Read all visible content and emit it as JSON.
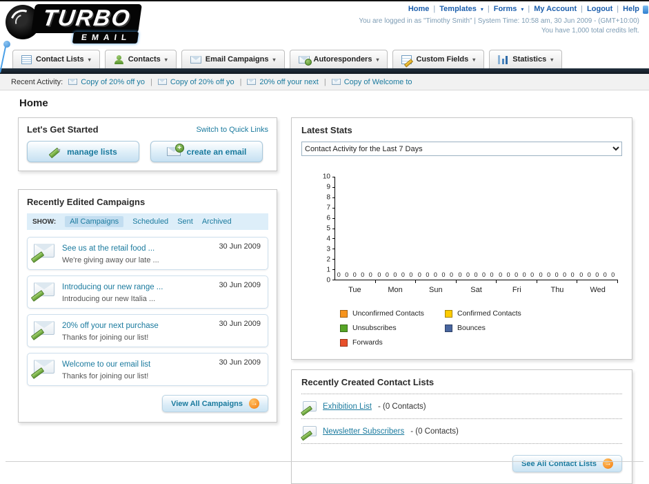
{
  "icons": {
    "caret": "▾",
    "pipe": "|",
    "arrow": "→"
  },
  "header": {
    "logo_title": "TURBO",
    "logo_subtitle": "EMAIL",
    "links": [
      {
        "label": "Home"
      },
      {
        "label": "Templates"
      },
      {
        "label": "Forms"
      },
      {
        "label": "My Account"
      },
      {
        "label": "Logout"
      },
      {
        "label": "Help"
      }
    ],
    "login_info": "You are logged in as \"Timothy Smith\" | System Time: 10:58 am, 30 Jun 2009 - (GMT+10:00)",
    "credits_info": "You have 1,000 total credits left."
  },
  "nav": {
    "tabs": [
      {
        "label": "Contact Lists"
      },
      {
        "label": "Contacts"
      },
      {
        "label": "Email Campaigns"
      },
      {
        "label": "Autoresponders"
      },
      {
        "label": "Custom Fields"
      },
      {
        "label": "Statistics"
      }
    ]
  },
  "recent_activity": {
    "label": "Recent Activity:",
    "items": [
      "Copy of 20% off yo",
      "Copy of 20% off yo",
      "20% off your next",
      "Copy of Welcome to"
    ]
  },
  "page": {
    "title": "Home"
  },
  "get_started": {
    "title": "Let's Get Started",
    "switch_link": "Switch to Quick Links",
    "manage_lists": "manage lists",
    "create_email": "create an email"
  },
  "campaigns": {
    "title": "Recently Edited Campaigns",
    "show_label": "SHOW:",
    "filters": [
      {
        "label": "All Campaigns"
      },
      {
        "label": "Scheduled"
      },
      {
        "label": "Sent"
      },
      {
        "label": "Archived"
      }
    ],
    "active_filter": "All Campaigns",
    "items": [
      {
        "title": "See us at the retail food ...",
        "subtitle": "We're giving away our late ...",
        "date": "30 Jun 2009"
      },
      {
        "title": "Introducing our new range ...",
        "subtitle": "Introducing our new Italia ...",
        "date": "30 Jun 2009"
      },
      {
        "title": "20% off your next purchase",
        "subtitle": "Thanks for joining our list!",
        "date": "30 Jun 2009"
      },
      {
        "title": "Welcome to our email list",
        "subtitle": "Thanks for joining our list!",
        "date": "30 Jun 2009"
      }
    ],
    "view_all": "View All Campaigns"
  },
  "stats": {
    "title": "Latest Stats",
    "filter_value": "Contact Activity for the Last 7 Days",
    "chart_data": {
      "type": "bar",
      "categories": [
        "Tue",
        "Mon",
        "Sun",
        "Sat",
        "Fri",
        "Thu",
        "Wed"
      ],
      "series": [
        {
          "name": "Unconfirmed Contacts",
          "values": [
            0,
            0,
            0,
            0,
            0,
            0,
            0
          ]
        },
        {
          "name": "Confirmed Contacts",
          "values": [
            0,
            0,
            0,
            0,
            0,
            0,
            0
          ]
        },
        {
          "name": "Unsubscribes",
          "values": [
            0,
            0,
            0,
            0,
            0,
            0,
            0
          ]
        },
        {
          "name": "Bounces",
          "values": [
            0,
            0,
            0,
            0,
            0,
            0,
            0
          ]
        },
        {
          "name": "Forwards",
          "values": [
            0,
            0,
            0,
            0,
            0,
            0,
            0
          ]
        }
      ],
      "ylim": [
        0,
        10
      ],
      "ytick_step": 1,
      "grid": false,
      "legend_position": "bottom"
    },
    "legend": [
      {
        "label": "Unconfirmed Contacts",
        "color": "#f7941d"
      },
      {
        "label": "Confirmed Contacts",
        "color": "#ffcc00"
      },
      {
        "label": "Unsubscribes",
        "color": "#56a526"
      },
      {
        "label": "Bounces",
        "color": "#48659e"
      },
      {
        "label": "Forwards",
        "color": "#e8502a"
      }
    ]
  },
  "contact_lists": {
    "title": "Recently Created Contact Lists",
    "items": [
      {
        "name": "Exhibition List",
        "suffix": "- (0 Contacts)"
      },
      {
        "name": "Newsletter Subscribers",
        "suffix": "- (0 Contacts)"
      }
    ],
    "see_all": "See All Contact Lists"
  }
}
